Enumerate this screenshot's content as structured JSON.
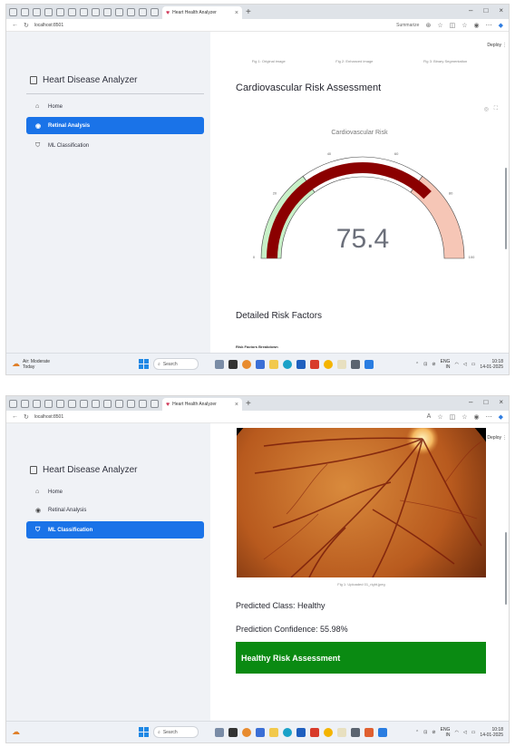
{
  "browser": {
    "tab_title": "Heart Health Analyzer",
    "tab_close": "×",
    "new_tab": "+",
    "url": "localhost:8501",
    "summarize_label": "Summarize",
    "win_minimize": "–",
    "win_maximize": "□",
    "win_close": "×"
  },
  "app": {
    "title": "Heart Disease Analyzer",
    "deploy_label": "Deploy",
    "nav": [
      {
        "label": "Home",
        "icon": "home-icon"
      },
      {
        "label": "Retinal Analysis",
        "icon": "eye-icon"
      },
      {
        "label": "ML Classification",
        "icon": "shield-icon"
      }
    ]
  },
  "screen1": {
    "active_nav": "Retinal Analysis",
    "image_captions": [
      "Fig 1: Original image",
      "Fig 2: Enhanced image",
      "Fig 3: Binary Segmentation"
    ],
    "section_title": "Cardiovascular Risk Assessment",
    "gauge": {
      "title": "Cardiovascular Risk",
      "value": 75.4,
      "value_text": "75.4",
      "min": 0,
      "max": 100,
      "bands": [
        {
          "from": 0,
          "to": 30,
          "color": "#c8f0c8"
        },
        {
          "from": 30,
          "to": 70,
          "color": "#ffffff"
        },
        {
          "from": 70,
          "to": 100,
          "color": "#f6c6b6"
        }
      ],
      "bar_color": "#8b0000",
      "tick_labels": [
        "0",
        "20",
        "40",
        "60",
        "80",
        "100"
      ]
    },
    "details_title": "Detailed Risk Factors",
    "details_sub": "Risk Factors Breakdown"
  },
  "screen2": {
    "active_nav": "ML Classification",
    "figure_caption": "Fig 1: Uploaded 01_right.jpeg",
    "predicted_class": "Predicted Class: Healthy",
    "prediction_confidence": "Prediction Confidence: 55.98%",
    "assessment_banner": "Healthy Risk Assessment"
  },
  "taskbar": {
    "weather_line1": "Air: Moderate",
    "weather_line2": "Today",
    "search_placeholder": "Search",
    "language": "ENG",
    "language_sub": "IN",
    "time1": "10:18",
    "date1": "14-01-2025",
    "time2": "10:18",
    "date2": "14-01-2025"
  }
}
